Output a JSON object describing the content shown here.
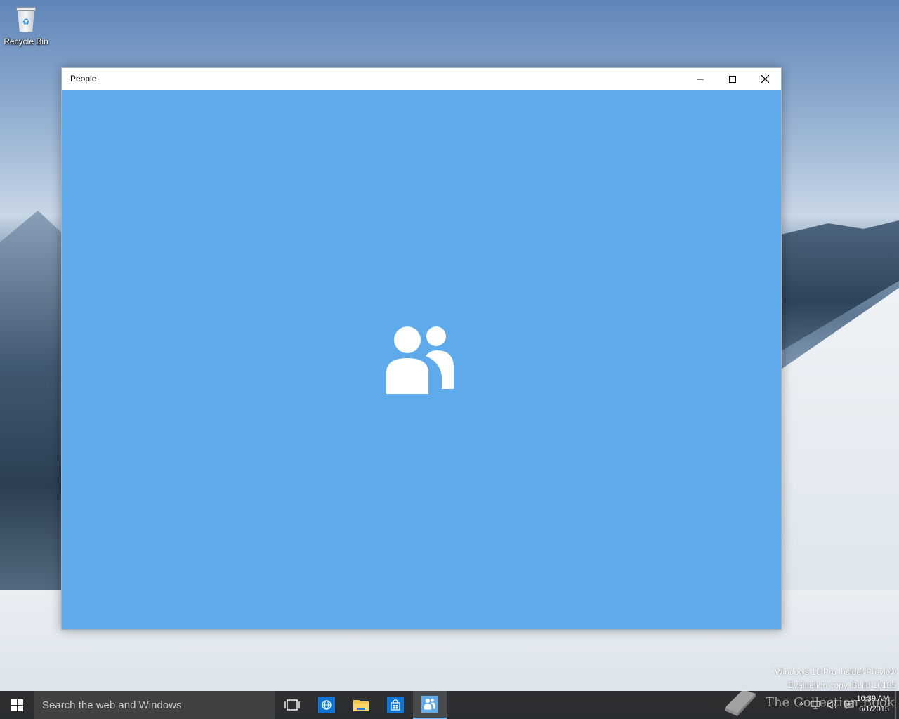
{
  "desktop": {
    "icons": [
      {
        "label": "Recycle Bin",
        "icon": "recycle-bin-icon"
      }
    ],
    "watermark": {
      "line1": "Windows 10 Pro Insider Preview",
      "line2": "Evaluation copy. Build 10135"
    }
  },
  "window": {
    "title": "People",
    "controls": {
      "minimize": "minimize-icon",
      "maximize": "maximize-icon",
      "close": "close-icon"
    },
    "splash": {
      "icon": "people-icon",
      "background": "#5eaaea"
    }
  },
  "taskbar": {
    "search_placeholder": "Search the web and Windows",
    "pinned": [
      {
        "name": "task-view",
        "icon": "task-view-icon"
      },
      {
        "name": "internet-explorer",
        "icon": "globe-icon"
      },
      {
        "name": "file-explorer",
        "icon": "folder-icon"
      },
      {
        "name": "store",
        "icon": "store-icon"
      },
      {
        "name": "people",
        "icon": "people-icon",
        "active": true
      }
    ],
    "clock": {
      "time": "10:39 AM",
      "date": "6/1/2015"
    },
    "overlay_text": "The Collection Book"
  }
}
